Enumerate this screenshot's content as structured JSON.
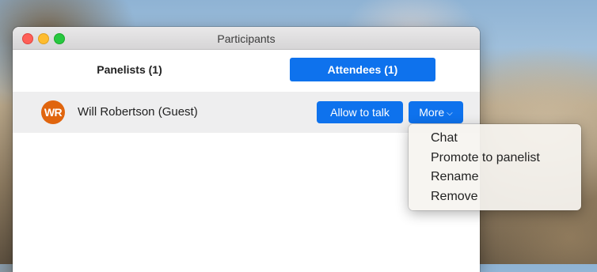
{
  "window": {
    "title": "Participants"
  },
  "tabs": {
    "panelists_label": "Panelists (1)",
    "attendees_label": "Attendees (1)"
  },
  "attendees": [
    {
      "initials": "WR",
      "name": "Will Robertson (Guest)",
      "allow_label": "Allow to talk",
      "more_label": "More"
    }
  ],
  "more_menu": {
    "items": [
      "Chat",
      "Promote to panelist",
      "Rename",
      "Remove"
    ]
  },
  "colors": {
    "accent": "#0e72ed",
    "avatar": "#e0650e",
    "row_background": "#eeeeef"
  }
}
